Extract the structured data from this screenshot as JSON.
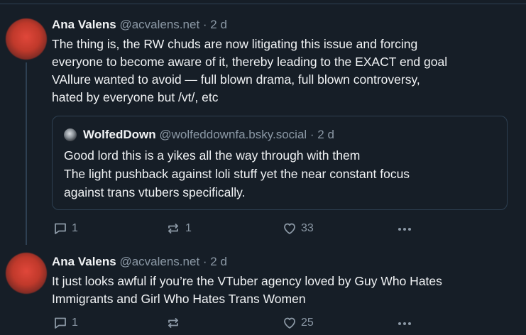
{
  "posts": [
    {
      "author_name": "Ana Valens",
      "handle_time": "@acvalens.net · 2 d",
      "text_lines": [
        "The thing is, the RW chuds are now litigating this issue and forcing",
        "everyone to become aware of it, thereby leading to the EXACT end goal",
        "VAllure wanted to avoid — full blown drama, full blown controversy,",
        "hated by everyone but /vt/, etc"
      ],
      "quote": {
        "author_name": "WolfedDown",
        "handle_time": "@wolfeddownfa.bsky.social · 2 d",
        "text_lines": [
          "Good lord this is a yikes all the way through with them",
          "The light pushback against loli stuff yet the near constant focus",
          "against trans vtubers specifically."
        ]
      },
      "actions": {
        "reply_count": "1",
        "repost_count": "1",
        "like_count": "33"
      }
    },
    {
      "author_name": "Ana Valens",
      "handle_time": "@acvalens.net · 2 d",
      "text_lines": [
        "It just looks awful if you’re the VTuber agency loved by Guy Who Hates",
        "Immigrants and Girl Who Hates Trans Women"
      ],
      "actions": {
        "reply_count": "1",
        "repost_count": "",
        "like_count": "25"
      }
    }
  ],
  "icons": {
    "reply": "reply-icon",
    "repost": "repost-icon",
    "like": "heart-icon",
    "more": "more-icon"
  },
  "colors": {
    "background": "#161e27",
    "text": "#f1f3f5",
    "muted": "#8b98a5",
    "border": "#2e4052"
  }
}
